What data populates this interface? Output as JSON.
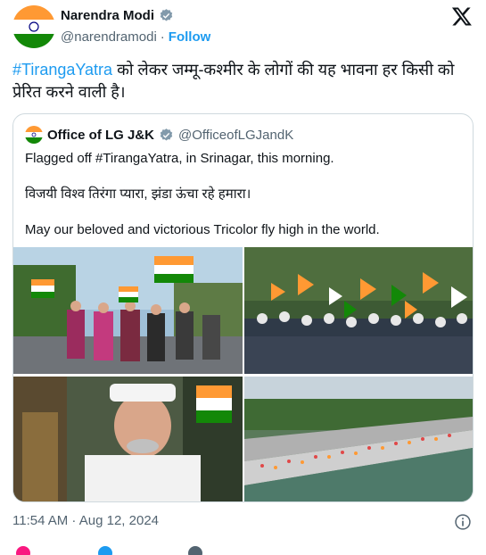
{
  "author": {
    "name": "Narendra Modi",
    "handle": "@narendramodi",
    "separator": "·",
    "follow_label": "Follow"
  },
  "tweet": {
    "hashtag": "#TirangaYatra",
    "text": " को लेकर जम्मू-कश्मीर के लोगों की यह भावना हर किसी को प्रेरित करने वाली है।"
  },
  "quoted": {
    "name": "Office of LG J&K",
    "handle": "@OfficeofLGJandK",
    "line1": "Flagged off #TirangaYatra, in Srinagar, this morning.",
    "line2": "विजयी विश्व तिरंगा प्यारा, झंडा ऊंचा रहे हमारा।",
    "line3": "May our beloved and victorious Tricolor fly high in the world."
  },
  "meta": {
    "timestamp": "11:54 AM · Aug 12, 2024"
  },
  "colors": {
    "accent": "#1d9bf0",
    "saffron": "#ff9933",
    "green": "#138808",
    "like": "#f91880"
  },
  "icons": [
    "verified-badge-icon",
    "x-logo-icon",
    "info-icon",
    "heart-icon",
    "reply-icon",
    "link-icon"
  ]
}
